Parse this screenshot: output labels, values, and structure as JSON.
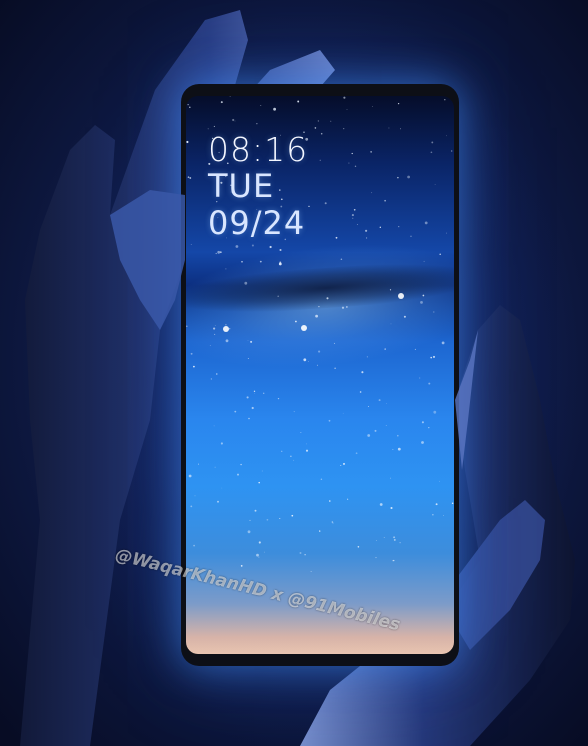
{
  "lockscreen": {
    "time": "08:16",
    "day": "TUE",
    "date": "09/24"
  },
  "watermark": {
    "text": "@WaqarKhanHD x @91Mobiles"
  },
  "colors": {
    "background": "#0a1433",
    "screen_top": "#050d2a",
    "screen_mid": "#2a86ee",
    "screen_bottom": "#e8c4b0",
    "glow": "#4696ff"
  }
}
